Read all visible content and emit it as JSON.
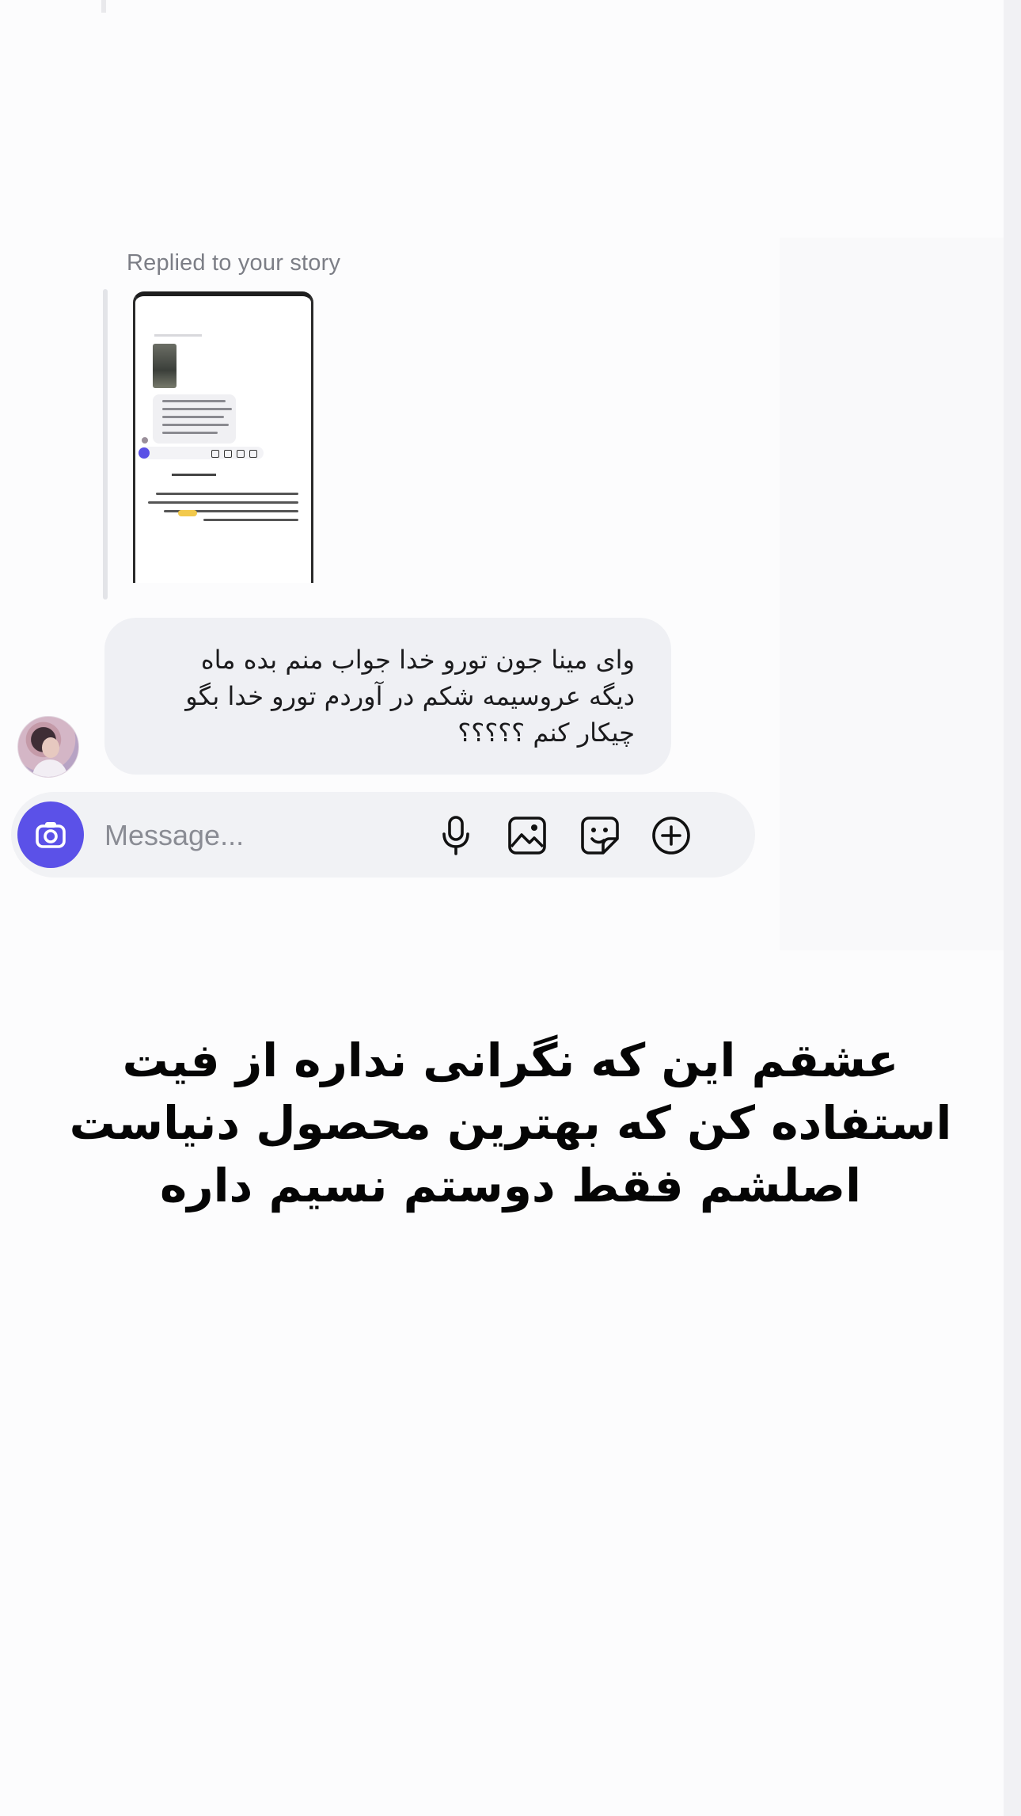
{
  "story_reply": {
    "label": "Replied to your story"
  },
  "message": {
    "text_lines": [
      "وای مینا جون تورو خدا جواب منم بده ماه",
      "دیگه عروسیمه شکم در آوردم تورو خدا بگو",
      "چیکار کنم ؟؟؟؟؟"
    ]
  },
  "composer": {
    "placeholder": "Message...",
    "icons": [
      "camera-icon",
      "microphone-icon",
      "gallery-icon",
      "sticker-icon",
      "add-icon"
    ],
    "accent_color": "#5b51e8"
  },
  "caption": {
    "lines": [
      "عشقم این که نگرانی نداره از فیت",
      "استفاده کن که بهترین محصول دنیاست",
      "اصلشم فقط دوستم نسیم داره"
    ]
  }
}
